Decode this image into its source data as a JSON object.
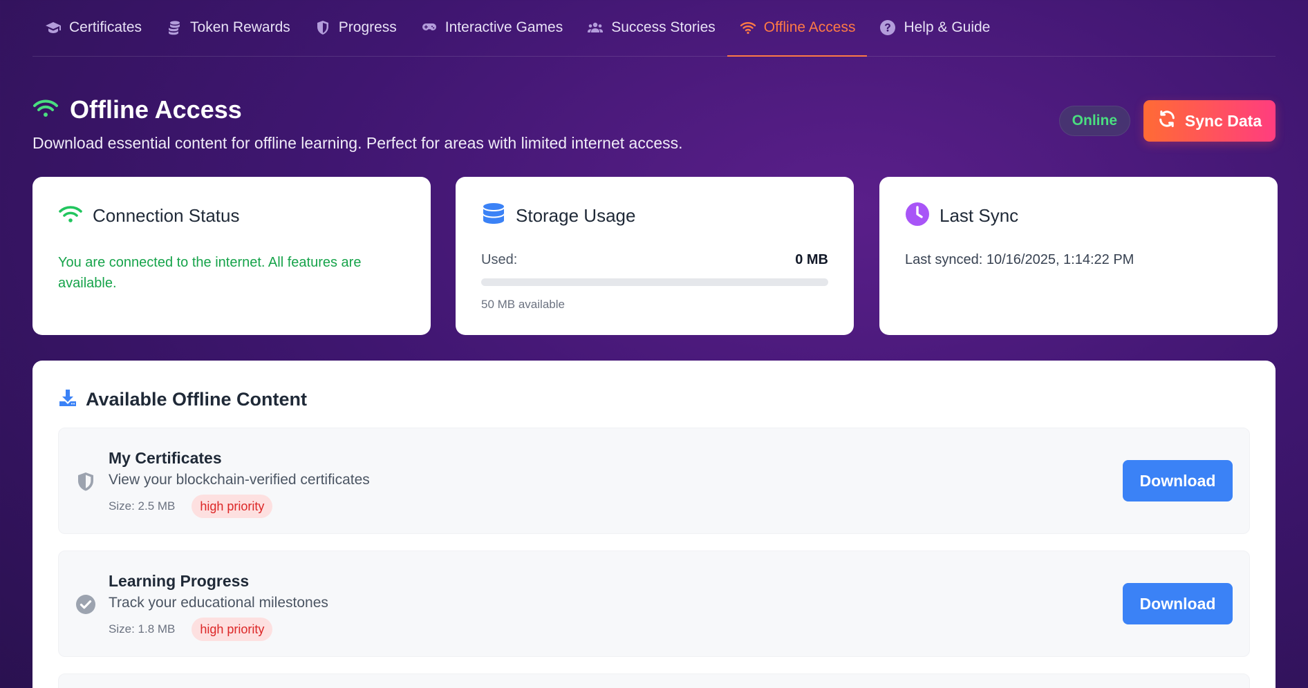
{
  "nav": {
    "items": [
      {
        "label": "Certificates",
        "icon": "graduation-cap-icon"
      },
      {
        "label": "Token Rewards",
        "icon": "coins-icon"
      },
      {
        "label": "Progress",
        "icon": "shield-icon"
      },
      {
        "label": "Interactive Games",
        "icon": "gamepad-icon"
      },
      {
        "label": "Success Stories",
        "icon": "users-icon"
      },
      {
        "label": "Offline Access",
        "icon": "wifi-icon",
        "active": true
      },
      {
        "label": "Help & Guide",
        "icon": "question-circle-icon"
      }
    ],
    "active_color": "#ff7a45"
  },
  "header": {
    "title": "Offline Access",
    "subtitle": "Download essential content for offline learning. Perfect for areas with limited internet access.",
    "status_badge": "Online",
    "sync_button": "Sync Data"
  },
  "cards": {
    "connection": {
      "title": "Connection Status",
      "text": "You are connected to the internet. All features are available."
    },
    "storage": {
      "title": "Storage Usage",
      "used_label": "Used:",
      "used_value": "0 MB",
      "used_fraction": 0,
      "available": "50 MB available"
    },
    "last_sync": {
      "title": "Last Sync",
      "text": "Last synced: 10/16/2025, 1:14:22 PM"
    }
  },
  "content": {
    "title": "Available Offline Content",
    "items": [
      {
        "title": "My Certificates",
        "description": "View your blockchain-verified certificates",
        "size": "Size: 2.5 MB",
        "priority": "high priority",
        "button": "Download",
        "icon": "shield-icon"
      },
      {
        "title": "Learning Progress",
        "description": "Track your educational milestones",
        "size": "Size: 1.8 MB",
        "priority": "high priority",
        "button": "Download",
        "icon": "check-circle-icon"
      }
    ]
  },
  "colors": {
    "accent_orange": "#ff7a45",
    "online_green": "#4ade80",
    "connected_green": "#16a34a",
    "primary_blue": "#3b82f6",
    "last_sync_purple": "#a855f7",
    "priority_red": "#dc2626"
  }
}
